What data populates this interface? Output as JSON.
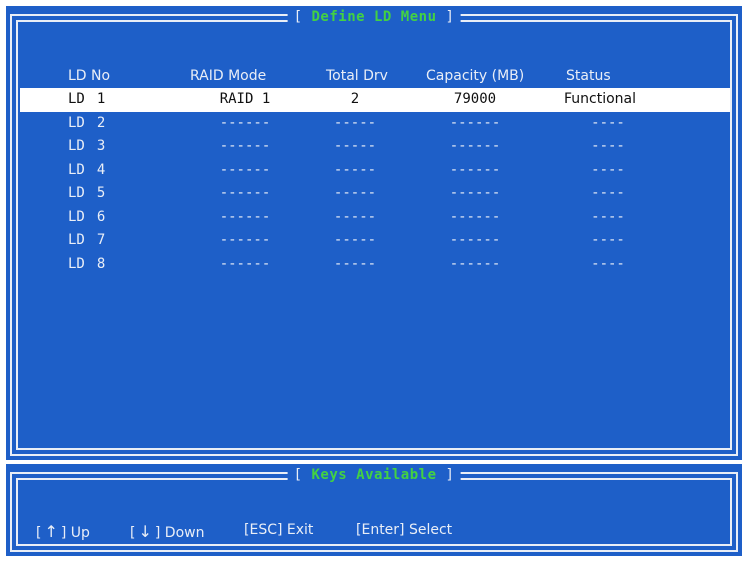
{
  "main_panel": {
    "title": "Define LD Menu",
    "title_bracket_left": "[",
    "title_bracket_right": "]"
  },
  "table": {
    "columns": {
      "ld_no": "LD No",
      "raid_mode": "RAID Mode",
      "total_drv": "Total Drv",
      "capacity": "Capacity (MB)",
      "status": "Status"
    },
    "rows": [
      {
        "ld": "LD",
        "num": "1",
        "raid_mode": "RAID 1",
        "total_drv": "2",
        "capacity": "79000",
        "status": "Functional",
        "selected": true
      },
      {
        "ld": "LD",
        "num": "2",
        "raid_mode": "------",
        "total_drv": "-----",
        "capacity": "------",
        "status": "----",
        "selected": false
      },
      {
        "ld": "LD",
        "num": "3",
        "raid_mode": "------",
        "total_drv": "-----",
        "capacity": "------",
        "status": "----",
        "selected": false
      },
      {
        "ld": "LD",
        "num": "4",
        "raid_mode": "------",
        "total_drv": "-----",
        "capacity": "------",
        "status": "----",
        "selected": false
      },
      {
        "ld": "LD",
        "num": "5",
        "raid_mode": "------",
        "total_drv": "-----",
        "capacity": "------",
        "status": "----",
        "selected": false
      },
      {
        "ld": "LD",
        "num": "6",
        "raid_mode": "------",
        "total_drv": "-----",
        "capacity": "------",
        "status": "----",
        "selected": false
      },
      {
        "ld": "LD",
        "num": "7",
        "raid_mode": "------",
        "total_drv": "-----",
        "capacity": "------",
        "status": "----",
        "selected": false
      },
      {
        "ld": "LD",
        "num": "8",
        "raid_mode": "------",
        "total_drv": "-----",
        "capacity": "------",
        "status": "----",
        "selected": false
      }
    ]
  },
  "keys_panel": {
    "title": "Keys Available",
    "title_bracket_left": "[",
    "title_bracket_right": "]",
    "keys": {
      "up": {
        "key": "↑",
        "label": "Up"
      },
      "down": {
        "key": "↓",
        "label": "Down"
      },
      "esc": {
        "key": "ESC",
        "label": "Exit"
      },
      "enter": {
        "key": "Enter",
        "label": "Select"
      }
    }
  },
  "colors": {
    "background": "#1e5fc8",
    "border": "#e9eef7",
    "title": "#43d143",
    "text": "#e9eef7",
    "selected_bg": "#ffffff",
    "selected_text": "#101010"
  }
}
